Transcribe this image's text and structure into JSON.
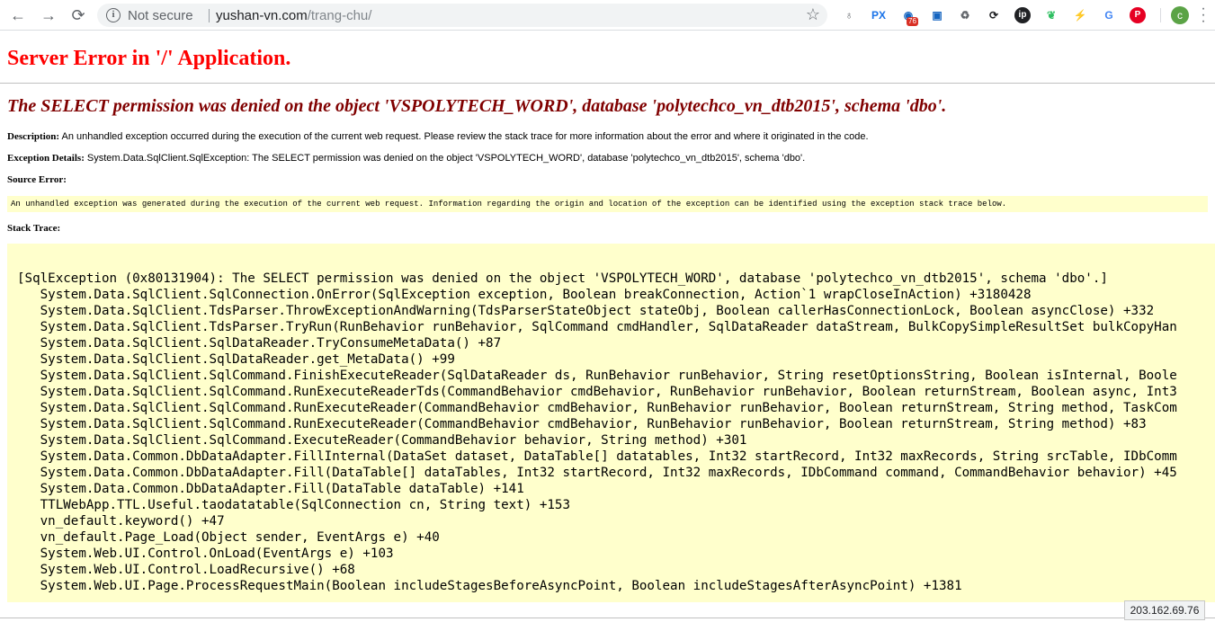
{
  "browser": {
    "security_label": "Not secure",
    "url_host": "yushan-vn.com",
    "url_path": "/trang-chu/",
    "extension_badge_count": "76",
    "profile_initial": "c",
    "extensions": [
      {
        "icon": "lightbulb-icon",
        "glyph": "♁",
        "color": "#5f6368"
      },
      {
        "icon": "px-icon",
        "glyph": "PX",
        "color": "#1a73e8"
      },
      {
        "icon": "globe-ext-icon",
        "glyph": "◉",
        "color": "#1565c0"
      },
      {
        "icon": "disk-ext-icon",
        "glyph": "▣",
        "color": "#1565c0"
      },
      {
        "icon": "recycle-icon",
        "glyph": "♻",
        "color": "#5f6368"
      },
      {
        "icon": "sync-icon",
        "glyph": "⟳",
        "color": "#202124"
      },
      {
        "icon": "ip-icon",
        "glyph": "ip",
        "color": "#ffffff"
      },
      {
        "icon": "evernote-icon",
        "glyph": "❦",
        "color": "#2dbe60"
      },
      {
        "icon": "lightning-icon",
        "glyph": "⚡",
        "color": "#9aa0a6"
      },
      {
        "icon": "translate-icon",
        "glyph": "G",
        "color": "#4285f4"
      },
      {
        "icon": "pinterest-icon",
        "glyph": "P",
        "color": "#ffffff"
      }
    ]
  },
  "page": {
    "heading": "Server Error in '/' Application.",
    "subheading": "The SELECT permission was denied on the object 'VSPOLYTECH_WORD', database 'polytechco_vn_dtb2015', schema 'dbo'.",
    "description_label": "Description:",
    "description_text": " An unhandled exception occurred during the execution of the current web request. Please review the stack trace for more information about the error and where it originated in the code.",
    "exception_label": "Exception Details:",
    "exception_text": " System.Data.SqlClient.SqlException: The SELECT permission was denied on the object 'VSPOLYTECH_WORD', database 'polytechco_vn_dtb2015', schema 'dbo'.",
    "source_error_label": "Source Error:",
    "source_error_text": "An unhandled exception was generated during the execution of the current web request. Information regarding the origin and location of the exception can be identified using the exception stack trace below.",
    "stack_trace_label": "Stack Trace:",
    "stack_trace": [
      "[SqlException (0x80131904): The SELECT permission was denied on the object 'VSPOLYTECH_WORD', database 'polytechco_vn_dtb2015', schema 'dbo'.]",
      "   System.Data.SqlClient.SqlConnection.OnError(SqlException exception, Boolean breakConnection, Action`1 wrapCloseInAction) +3180428",
      "   System.Data.SqlClient.TdsParser.ThrowExceptionAndWarning(TdsParserStateObject stateObj, Boolean callerHasConnectionLock, Boolean asyncClose) +332",
      "   System.Data.SqlClient.TdsParser.TryRun(RunBehavior runBehavior, SqlCommand cmdHandler, SqlDataReader dataStream, BulkCopySimpleResultSet bulkCopyHan",
      "   System.Data.SqlClient.SqlDataReader.TryConsumeMetaData() +87",
      "   System.Data.SqlClient.SqlDataReader.get_MetaData() +99",
      "   System.Data.SqlClient.SqlCommand.FinishExecuteReader(SqlDataReader ds, RunBehavior runBehavior, String resetOptionsString, Boolean isInternal, Boole",
      "   System.Data.SqlClient.SqlCommand.RunExecuteReaderTds(CommandBehavior cmdBehavior, RunBehavior runBehavior, Boolean returnStream, Boolean async, Int3",
      "   System.Data.SqlClient.SqlCommand.RunExecuteReader(CommandBehavior cmdBehavior, RunBehavior runBehavior, Boolean returnStream, String method, TaskCom",
      "   System.Data.SqlClient.SqlCommand.RunExecuteReader(CommandBehavior cmdBehavior, RunBehavior runBehavior, Boolean returnStream, String method) +83",
      "   System.Data.SqlClient.SqlCommand.ExecuteReader(CommandBehavior behavior, String method) +301",
      "   System.Data.Common.DbDataAdapter.FillInternal(DataSet dataset, DataTable[] datatables, Int32 startRecord, Int32 maxRecords, String srcTable, IDbComm",
      "   System.Data.Common.DbDataAdapter.Fill(DataTable[] dataTables, Int32 startRecord, Int32 maxRecords, IDbCommand command, CommandBehavior behavior) +45",
      "   System.Data.Common.DbDataAdapter.Fill(DataTable dataTable) +141",
      "   TTLWebApp.TTL.Useful.taodatatable(SqlConnection cn, String text) +153",
      "   vn_default.keyword() +47",
      "   vn_default.Page_Load(Object sender, EventArgs e) +40",
      "   System.Web.UI.Control.OnLoad(EventArgs e) +103",
      "   System.Web.UI.Control.LoadRecursive() +68",
      "   System.Web.UI.Page.ProcessRequestMain(Boolean includeStagesBeforeAsyncPoint, Boolean includeStagesAfterAsyncPoint) +1381"
    ],
    "status_tooltip": "203.162.69.76"
  }
}
